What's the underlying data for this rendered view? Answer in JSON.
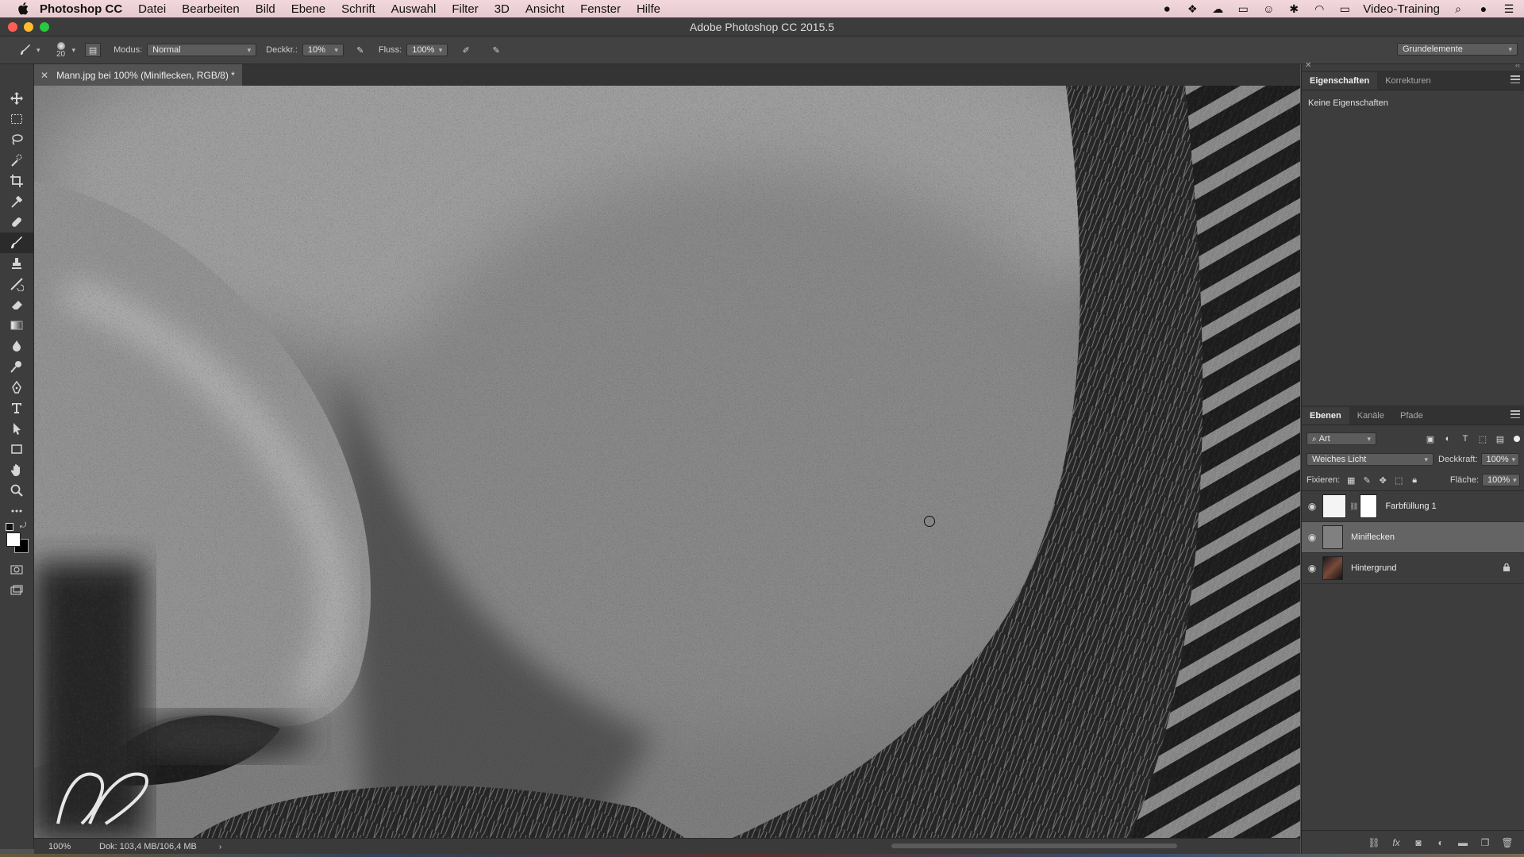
{
  "menubar": {
    "app_name": "Photoshop CC",
    "menus": [
      "Datei",
      "Bearbeiten",
      "Bild",
      "Ebene",
      "Schrift",
      "Auswahl",
      "Filter",
      "3D",
      "Ansicht",
      "Fenster",
      "Hilfe"
    ],
    "user": "Video-Training"
  },
  "window": {
    "title": "Adobe Photoshop CC 2015.5"
  },
  "options": {
    "brush_size": "20",
    "mode_label": "Modus:",
    "mode_value": "Normal",
    "opacity_label": "Deckkr.:",
    "opacity_value": "10%",
    "flow_label": "Fluss:",
    "flow_value": "100%",
    "workspace": "Grundelemente"
  },
  "document": {
    "tab_title": "Mann.jpg bei 100% (Miniflecken, RGB/8) *",
    "zoom": "100%",
    "doc_info": "Dok: 103,4 MB/106,4 MB"
  },
  "properties_panel": {
    "tabs": [
      "Eigenschaften",
      "Korrekturen"
    ],
    "empty_text": "Keine Eigenschaften"
  },
  "layers_panel": {
    "tabs": [
      "Ebenen",
      "Kanäle",
      "Pfade"
    ],
    "filter_kind": "Art",
    "blend_mode": "Weiches Licht",
    "opacity_label": "Deckkraft:",
    "opacity_value": "100%",
    "lock_label": "Fixieren:",
    "fill_label": "Fläche:",
    "fill_value": "100%",
    "layers": [
      {
        "name": "Farbfüllung 1",
        "visible": true,
        "selected": false
      },
      {
        "name": "Miniflecken",
        "visible": true,
        "selected": true
      },
      {
        "name": "Hintergrund",
        "visible": true,
        "selected": false,
        "locked": true
      }
    ]
  },
  "colors": {
    "menubar": "#ecd0d5",
    "panel": "#3d3d3d",
    "selected_layer": "#646464",
    "close": "#ff5f57",
    "minimize": "#febc2e",
    "zoom": "#28c840"
  },
  "toolbox_icons": [
    "move-icon",
    "marquee-icon",
    "lasso-icon",
    "quick-selection-icon",
    "crop-icon",
    "eyedropper-icon",
    "healing-brush-icon",
    "brush-icon",
    "clone-stamp-icon",
    "history-brush-icon",
    "eraser-icon",
    "gradient-icon",
    "blur-icon",
    "dodge-icon",
    "pen-icon",
    "type-icon",
    "path-selection-icon",
    "rectangle-icon",
    "hand-icon",
    "zoom-icon",
    "more-tools-icon"
  ]
}
